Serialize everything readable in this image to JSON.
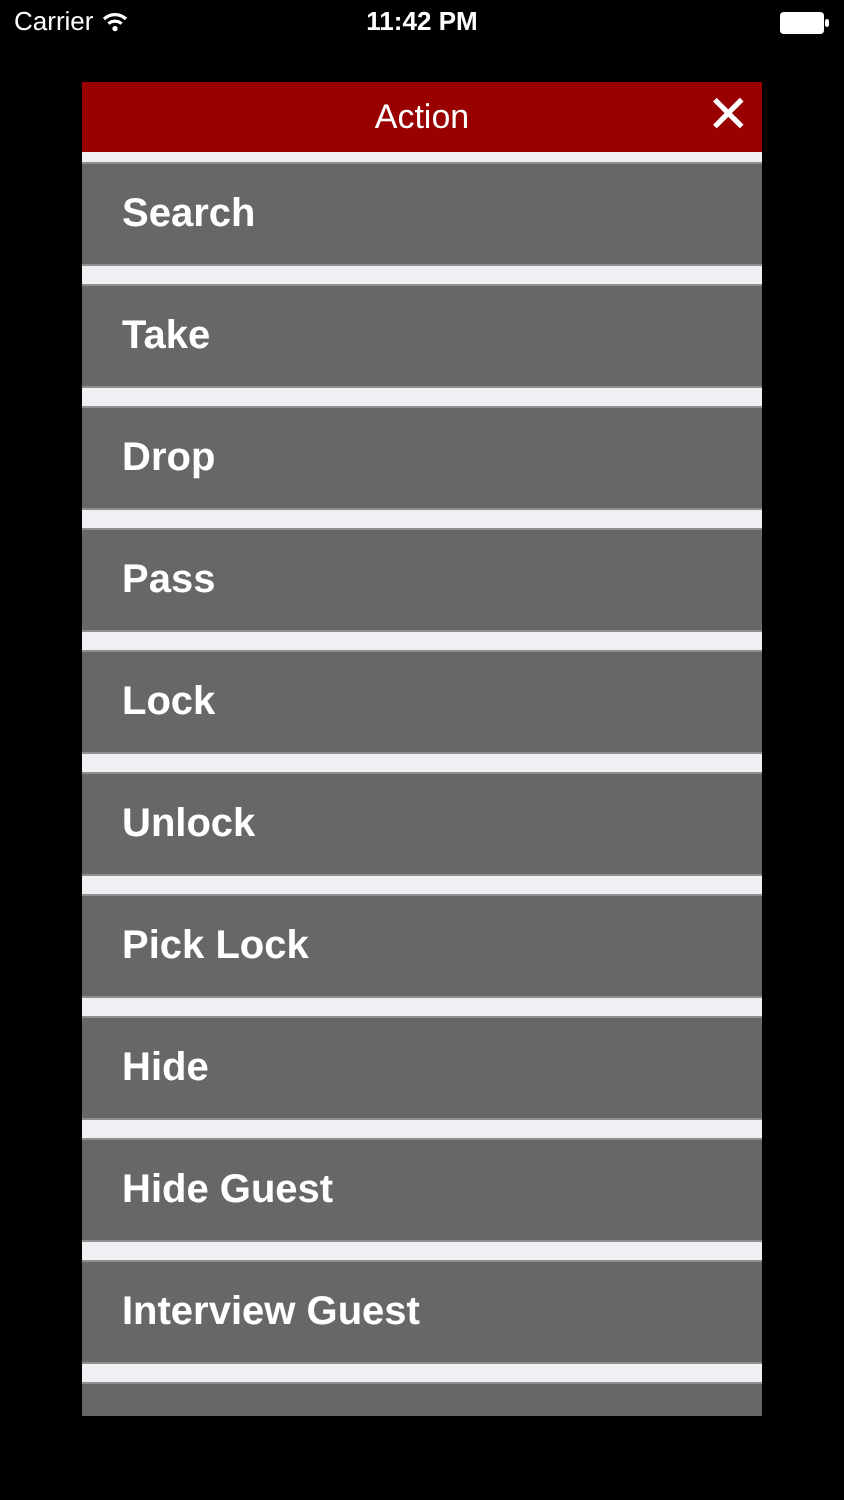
{
  "status_bar": {
    "carrier": "Carrier",
    "time": "11:42 PM"
  },
  "dialog": {
    "title": "Action",
    "close": "✕"
  },
  "actions": [
    {
      "label": "Search"
    },
    {
      "label": "Take"
    },
    {
      "label": "Drop"
    },
    {
      "label": "Pass"
    },
    {
      "label": "Lock"
    },
    {
      "label": "Unlock"
    },
    {
      "label": "Pick Lock"
    },
    {
      "label": "Hide"
    },
    {
      "label": "Hide Guest"
    },
    {
      "label": "Interview Guest"
    }
  ]
}
